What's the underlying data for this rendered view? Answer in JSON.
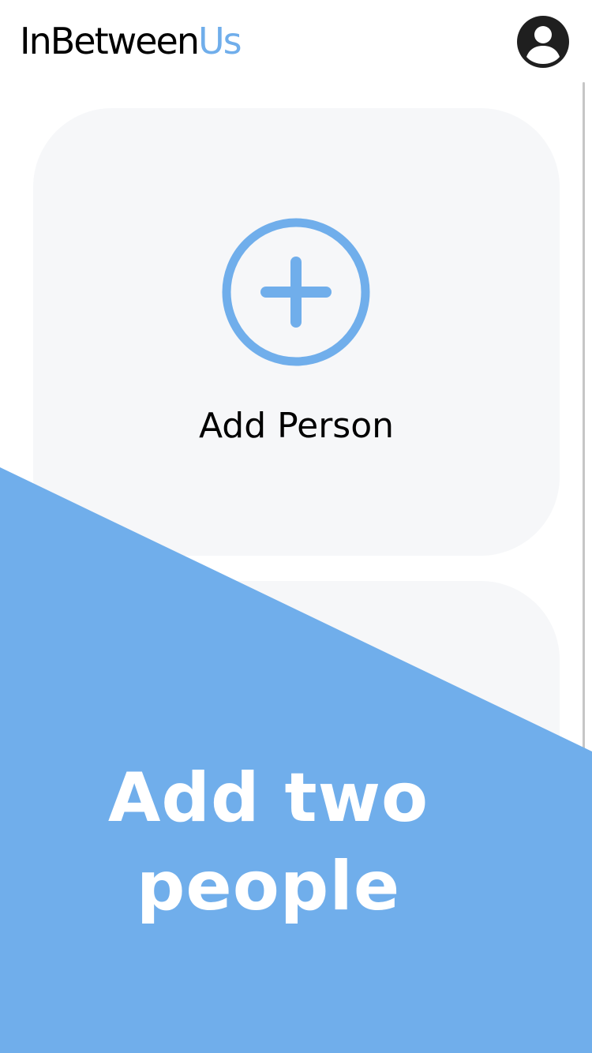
{
  "app": {
    "logo_primary": "InBetween",
    "logo_accent": "Us",
    "accent_color": "#70aeeb"
  },
  "header": {
    "avatar_icon": "account-circle-icon"
  },
  "cards": [
    {
      "icon": "plus-circle-icon",
      "label": "Add Person"
    },
    {
      "icon": "",
      "label": ""
    }
  ],
  "banner": {
    "line1": "Add two",
    "line2": "people",
    "background_color": "#70aeeb"
  }
}
